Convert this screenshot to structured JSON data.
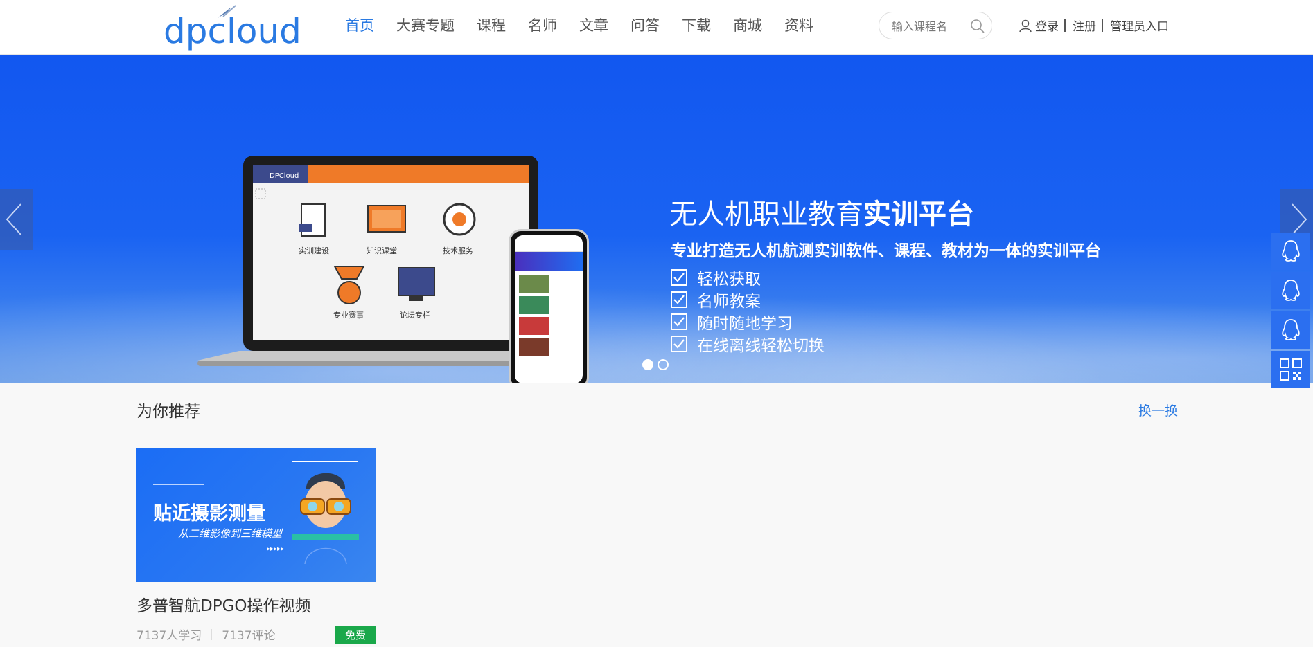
{
  "logo": {
    "text": "dpcloud"
  },
  "nav": {
    "items": [
      {
        "label": "首页",
        "active": true
      },
      {
        "label": "大赛专题"
      },
      {
        "label": "课程"
      },
      {
        "label": "名师"
      },
      {
        "label": "文章"
      },
      {
        "label": "问答"
      },
      {
        "label": "下载"
      },
      {
        "label": "商城"
      },
      {
        "label": "资料"
      }
    ]
  },
  "search": {
    "placeholder": "输入课程名"
  },
  "auth": {
    "login": "登录",
    "register": "注册",
    "admin": "管理员入口"
  },
  "banner": {
    "headline_normal": "无人机职业教育",
    "headline_bold": "实训平台",
    "subline": "专业打造无人机航测实训软件、课程、教材为一体的实训平台",
    "features": [
      "轻松获取",
      "名师教案",
      "随时随地学习",
      "在线离线轻松切换"
    ],
    "laptop_app": {
      "brand": "DPCloud",
      "tiles": [
        "实训建设",
        "知识课堂",
        "技术服务",
        "专业赛事",
        "论坛专栏"
      ]
    },
    "active_slide": 1,
    "slide_count": 2
  },
  "colors": {
    "accent": "#2a7ae2",
    "banner": "#1a63f2",
    "free_badge": "#1aa84a"
  },
  "recommend": {
    "title": "为你推荐",
    "more": "换一换",
    "cards": [
      {
        "thumb_title": "贴近摄影测量",
        "thumb_sub": "从二维影像到三维模型",
        "title": "多普智航DPGO操作视频",
        "learners": "7137人学习",
        "comments": "7137评论",
        "badge": "免费"
      }
    ]
  }
}
